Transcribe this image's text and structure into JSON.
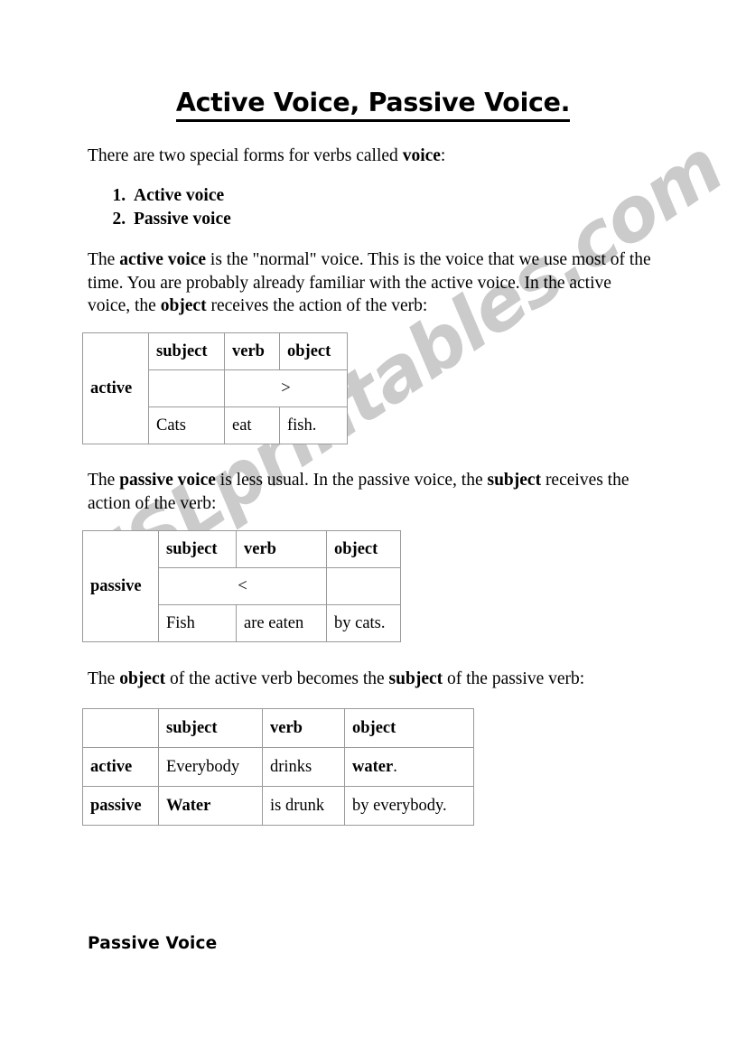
{
  "document": {
    "title": "Active Voice, Passive Voice.",
    "bottom_heading": "Passive Voice"
  },
  "watermark": {
    "text": "ESLprintables.com",
    "color": "#c9c9c9"
  },
  "paragraphs": {
    "intro": {
      "before": "There are two special forms for verbs called ",
      "bold": "voice",
      "after": ":"
    },
    "active": {
      "p1": "The ",
      "b1": "active voice",
      "p2": " is the \"normal\" voice. This is the voice that we use most of the time. You are probably already familiar with the active voice. In the active voice, the ",
      "b2": "object",
      "p3": " receives the action of the verb:"
    },
    "passive": {
      "p1": "The ",
      "b1": "passive voice",
      "p2": " is less usual. In the passive voice, the ",
      "b2": "subject",
      "p3": " receives the action of the verb:"
    },
    "object": {
      "p1": "The ",
      "b1": "object",
      "p2": " of the active verb becomes the ",
      "b2": "subject",
      "p3": " of the passive verb:"
    }
  },
  "list": {
    "items": [
      "Active voice",
      "Passive voice"
    ]
  },
  "tables": {
    "active_cats": {
      "row_label": "active",
      "headers": [
        "subject",
        "verb",
        "object"
      ],
      "arrow": ">",
      "example": [
        "Cats",
        "eat",
        "fish."
      ]
    },
    "passive_fish": {
      "row_label": "passive",
      "headers": [
        "subject",
        "verb",
        "object"
      ],
      "arrow": "<",
      "example": [
        "Fish",
        "are eaten",
        "by cats."
      ]
    },
    "water": {
      "headers": [
        "subject",
        "verb",
        "object"
      ],
      "rows": [
        {
          "label": "active",
          "subject": "Everybody",
          "verb": "drinks",
          "object_bold": "water",
          "object_tail": "."
        },
        {
          "label": "passive",
          "subject": "Water",
          "verb": "is drunk",
          "object_bold": "by everybody.",
          "object_tail": ""
        }
      ]
    }
  }
}
